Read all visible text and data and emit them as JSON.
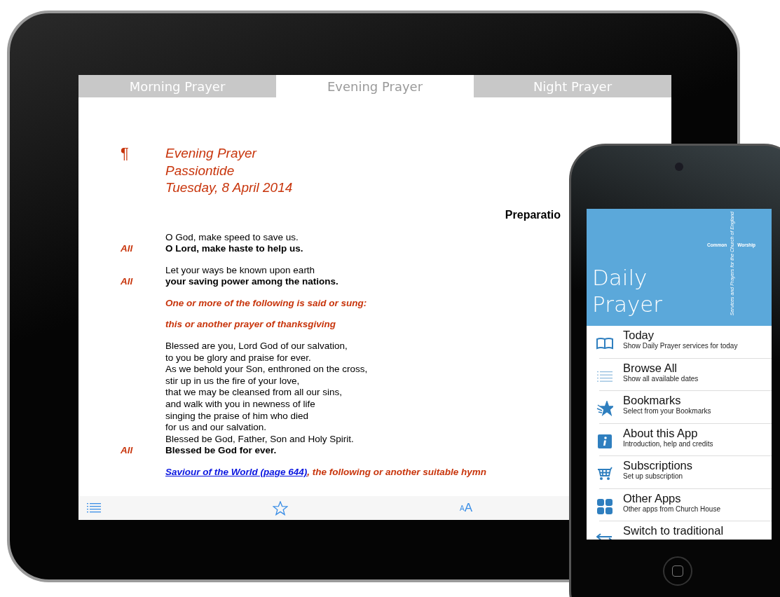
{
  "ipad": {
    "tabs": [
      {
        "label": "Morning Prayer",
        "selected": false
      },
      {
        "label": "Evening Prayer",
        "selected": true
      },
      {
        "label": "Night Prayer",
        "selected": false
      }
    ],
    "heading": {
      "mark": "¶",
      "lines": [
        "Evening Prayer",
        "Passiontide",
        "Tuesday, 8 April 2014"
      ]
    },
    "section_title": "Preparatio",
    "blocks": [
      {
        "lines": [
          {
            "kind": "plain",
            "text": "O God, make speed to save us."
          },
          {
            "kind": "response",
            "label": "All",
            "text": "O Lord, make haste to help us."
          }
        ]
      },
      {
        "lines": [
          {
            "kind": "plain",
            "text": "Let your ways be known upon earth"
          },
          {
            "kind": "response",
            "label": "All",
            "text": "your saving power among the nations."
          }
        ]
      },
      {
        "lines": [
          {
            "kind": "rubric",
            "text": "One or more of the following is said or sung:"
          }
        ]
      },
      {
        "lines": [
          {
            "kind": "rubric",
            "text": "this or another prayer of thanksgiving"
          }
        ]
      },
      {
        "lines": [
          {
            "kind": "plain",
            "text": "Blessed are you, Lord God of our salvation,"
          },
          {
            "kind": "plain",
            "text": "to you be glory and praise for ever."
          },
          {
            "kind": "plain",
            "text": "As we behold your Son, enthroned on the cross,"
          },
          {
            "kind": "plain",
            "text": "stir up in us the fire of your love,"
          },
          {
            "kind": "plain",
            "text": "that we may be cleansed from all our sins,"
          },
          {
            "kind": "plain",
            "text": "and walk with you in newness of life"
          },
          {
            "kind": "plain",
            "text": "singing the praise of him who died"
          },
          {
            "kind": "plain",
            "text": "for us and our salvation."
          },
          {
            "kind": "plain",
            "text": "Blessed be God, Father, Son and Holy Spirit."
          },
          {
            "kind": "response",
            "label": "All",
            "text": "Blessed be God for ever."
          }
        ]
      },
      {
        "lines": [
          {
            "kind": "link_rubric",
            "link": "Saviour of the World (page 644)",
            "text": ", the following or another suitable hymn"
          }
        ]
      }
    ],
    "toolbar": {
      "font_size_small": "A",
      "font_size_large": "A"
    }
  },
  "iphone": {
    "title_lines": [
      "Daily",
      "Prayer"
    ],
    "logo": {
      "left": "Common",
      "right": "Worship",
      "vertical": "Services and Prayers for the Church of England"
    },
    "menu": [
      {
        "kind": "book",
        "title": "Today",
        "subtitle": "Show Daily Prayer services for today"
      },
      {
        "kind": "list",
        "title": "Browse All",
        "subtitle": "Show all available dates"
      },
      {
        "kind": "stars",
        "title": "Bookmarks",
        "subtitle": "Select from your Bookmarks"
      },
      {
        "kind": "info",
        "title": "About this App",
        "subtitle": "Introduction, help and credits"
      },
      {
        "kind": "cart",
        "title": "Subscriptions",
        "subtitle": "Set up subscription"
      },
      {
        "kind": "grid",
        "title": "Other Apps",
        "subtitle": "Other apps from Church House"
      },
      {
        "kind": "arrows",
        "title": "Switch to traditional"
      }
    ]
  }
}
